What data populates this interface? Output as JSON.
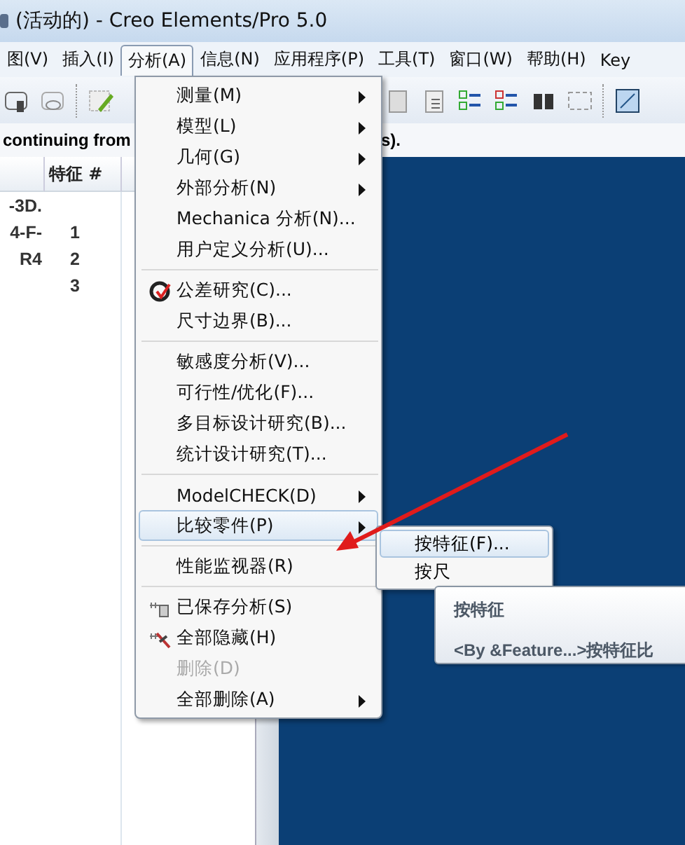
{
  "window": {
    "title": "(活动的) - Creo Elements/Pro 5.0"
  },
  "menu_bar": [
    {
      "label": "图(V)",
      "selected": false
    },
    {
      "label": "插入(I)",
      "selected": false
    },
    {
      "label": "分析(A)",
      "selected": true
    },
    {
      "label": "信息(N)",
      "selected": false
    },
    {
      "label": "应用程序(P)",
      "selected": false
    },
    {
      "label": "工具(T)",
      "selected": false
    },
    {
      "label": "窗口(W)",
      "selected": false
    },
    {
      "label": "帮助(H)",
      "selected": false
    },
    {
      "label": "Key",
      "selected": false
    }
  ],
  "message": [
    "continuing from",
    "s)."
  ],
  "model_tree": {
    "column_2": "特征 #",
    "rows": [
      {
        "name": "-3D."
      },
      {
        "name": "4-F-",
        "feature_no": "1"
      },
      {
        "name": "R4",
        "feature_no": "2"
      },
      {
        "feature_no": "3"
      }
    ]
  },
  "analysis_menu": {
    "items": [
      {
        "kind": "item",
        "label": "测量(M)",
        "submenu": true
      },
      {
        "kind": "item",
        "label": "模型(L)",
        "submenu": true
      },
      {
        "kind": "item",
        "label": "几何(G)",
        "submenu": true
      },
      {
        "kind": "item",
        "label": "外部分析(N)",
        "submenu": true
      },
      {
        "kind": "item",
        "label": "Mechanica 分析(N)..."
      },
      {
        "kind": "item",
        "label": "用户定义分析(U)..."
      },
      {
        "kind": "separator"
      },
      {
        "kind": "tolerance",
        "label": "公差研究(C)..."
      },
      {
        "kind": "item",
        "label": "尺寸边界(B)..."
      },
      {
        "kind": "separator"
      },
      {
        "kind": "item",
        "label": "敏感度分析(V)..."
      },
      {
        "kind": "item",
        "label": "可行性/优化(F)..."
      },
      {
        "kind": "item",
        "label": "多目标设计研究(B)..."
      },
      {
        "kind": "item",
        "label": "统计设计研究(T)..."
      },
      {
        "kind": "separator"
      },
      {
        "kind": "item",
        "label": "ModelCHECK(D)",
        "submenu": true
      },
      {
        "kind": "item",
        "label": "比较零件(P)",
        "submenu": true,
        "selected": true
      },
      {
        "kind": "separator"
      },
      {
        "kind": "item",
        "label": "性能监视器(R)"
      },
      {
        "kind": "separator"
      },
      {
        "kind": "saved",
        "label": "已保存分析(S)"
      },
      {
        "kind": "hide",
        "label": "全部隐藏(H)"
      },
      {
        "kind": "item",
        "label": "删除(D)",
        "disabled": true
      },
      {
        "kind": "item",
        "label": "全部删除(A)",
        "submenu": true
      }
    ]
  },
  "compare_submenu": {
    "items": [
      {
        "label": "按特征(F)...",
        "selected": true
      },
      {
        "label": "按尺",
        "selected": false
      }
    ]
  },
  "tooltip": {
    "title": "按特征",
    "text": "<By &Feature...>按特征比"
  }
}
